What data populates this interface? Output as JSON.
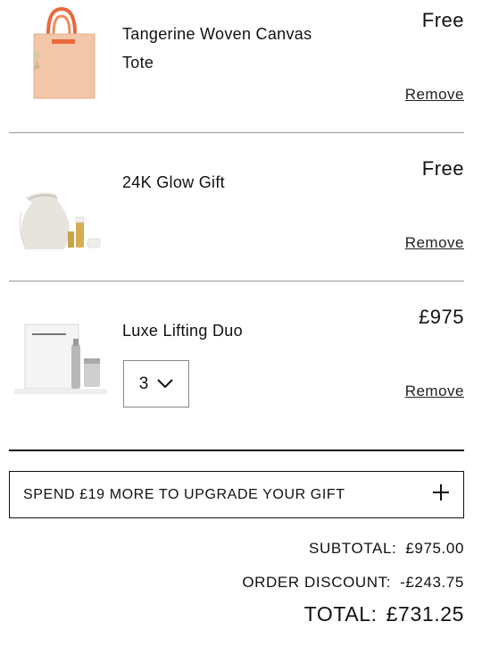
{
  "cart": {
    "items": [
      {
        "name_line1": "Tangerine Woven Canvas",
        "name_line2": "Tote",
        "price": "Free",
        "remove_label": "Remove"
      },
      {
        "name_line1": "24K Glow Gift",
        "price": "Free",
        "remove_label": "Remove"
      },
      {
        "name_line1": "Luxe Lifting Duo",
        "price": "£975",
        "remove_label": "Remove",
        "quantity": "3"
      }
    ]
  },
  "promo": {
    "text": "SPEND £19 MORE TO UPGRADE YOUR GIFT",
    "icon": "plus-icon"
  },
  "totals": {
    "subtotal_label": "SUBTOTAL:",
    "subtotal_value": "£975.00",
    "discount_label": "ORDER DISCOUNT:",
    "discount_value": "-£243.75",
    "total_label": "TOTAL:",
    "total_value": "£731.25"
  }
}
